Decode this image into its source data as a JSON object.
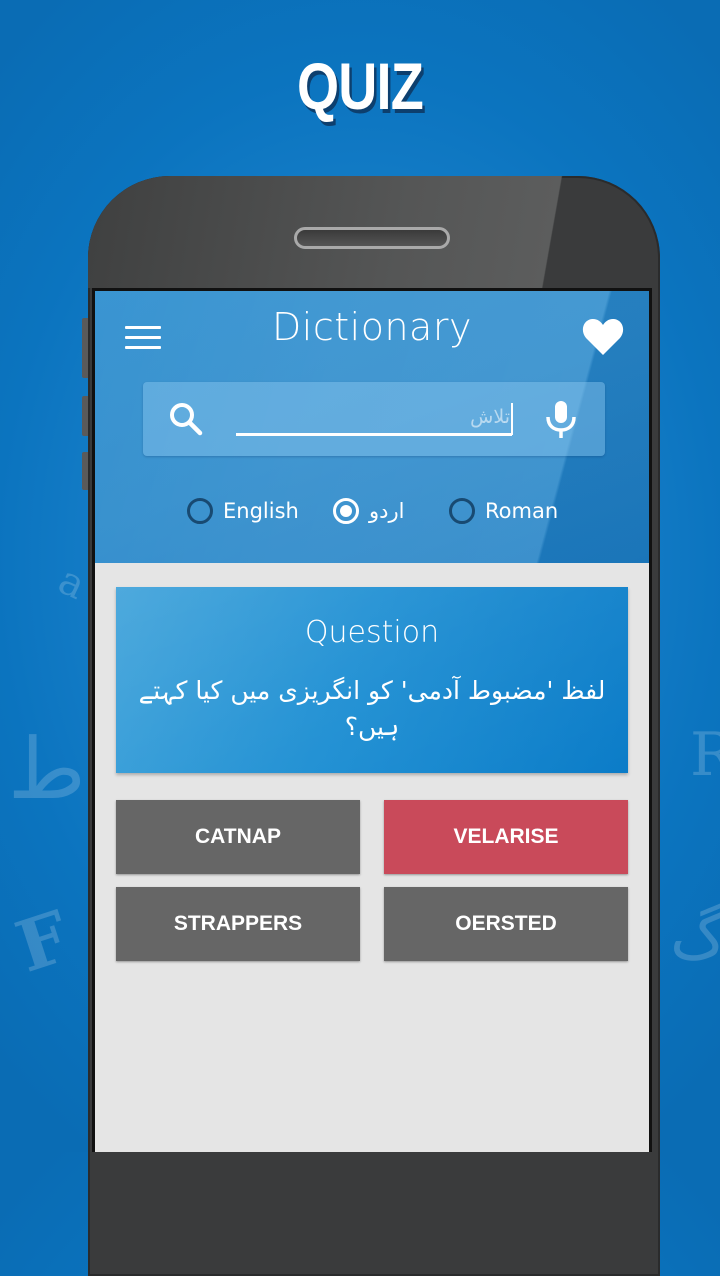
{
  "promo": {
    "title": "QUIZ"
  },
  "background_glyphs": [
    "ط",
    "F",
    "R",
    "گ",
    "a"
  ],
  "app": {
    "title": "Dictionary",
    "icons": {
      "menu": "menu-icon",
      "favorite": "heart-icon",
      "search": "search-icon",
      "voice": "microphone-icon"
    },
    "search": {
      "value": "",
      "placeholder": "تلاش"
    },
    "languages": [
      {
        "label": "English",
        "selected": false
      },
      {
        "label": "اردو",
        "selected": true
      },
      {
        "label": "Roman",
        "selected": false
      }
    ]
  },
  "quiz": {
    "heading": "Question",
    "question": "لفظ 'مضبوط آدمی' کو انگریزی میں کیا کہتے ہیں؟",
    "answers": [
      {
        "label": "CATNAP",
        "state": "neutral"
      },
      {
        "label": "VELARISE",
        "state": "wrong"
      },
      {
        "label": "STRAPPERS",
        "state": "neutral"
      },
      {
        "label": "OERSTED",
        "state": "neutral"
      }
    ]
  },
  "colors": {
    "header_blue": "#2b8acb",
    "wrong_answer": "#c94a5a",
    "answer_gray": "#666666",
    "content_bg": "#e5e5e5"
  }
}
